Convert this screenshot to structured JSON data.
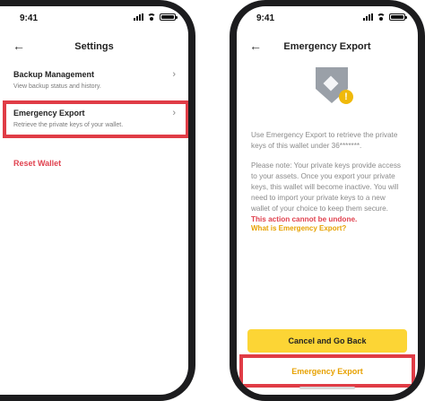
{
  "status_bar": {
    "time": "9:41"
  },
  "settings_screen": {
    "title": "Settings",
    "items": [
      {
        "title": "Backup Management",
        "description": "View backup status and history."
      },
      {
        "title": "Emergency Export",
        "description": "Retrieve the private keys of your wallet."
      }
    ],
    "reset_label": "Reset Wallet"
  },
  "export_screen": {
    "title": "Emergency Export",
    "paragraph1": "Use Emergency Export to retrieve the private keys of this wallet under 36*******.",
    "paragraph2": "Please note: Your private keys provide access to your assets. Once you export your private keys, this wallet will become inactive. You will need to import your private keys to a new wallet of your choice to keep them secure.",
    "paragraph2_warning": "This action cannot be undone.",
    "link_label": "What is Emergency Export?",
    "primary_button": "Cancel and Go Back",
    "secondary_button": "Emergency Export"
  },
  "colors": {
    "accent_yellow": "#fcd535",
    "link_yellow": "#e7a100",
    "highlight_red": "#e03c46",
    "danger_red": "#e0424f"
  },
  "icons": {
    "back": "arrow-left-icon",
    "chevron": "chevron-right-icon",
    "shield": "shield-icon",
    "warning": "warning-icon"
  }
}
